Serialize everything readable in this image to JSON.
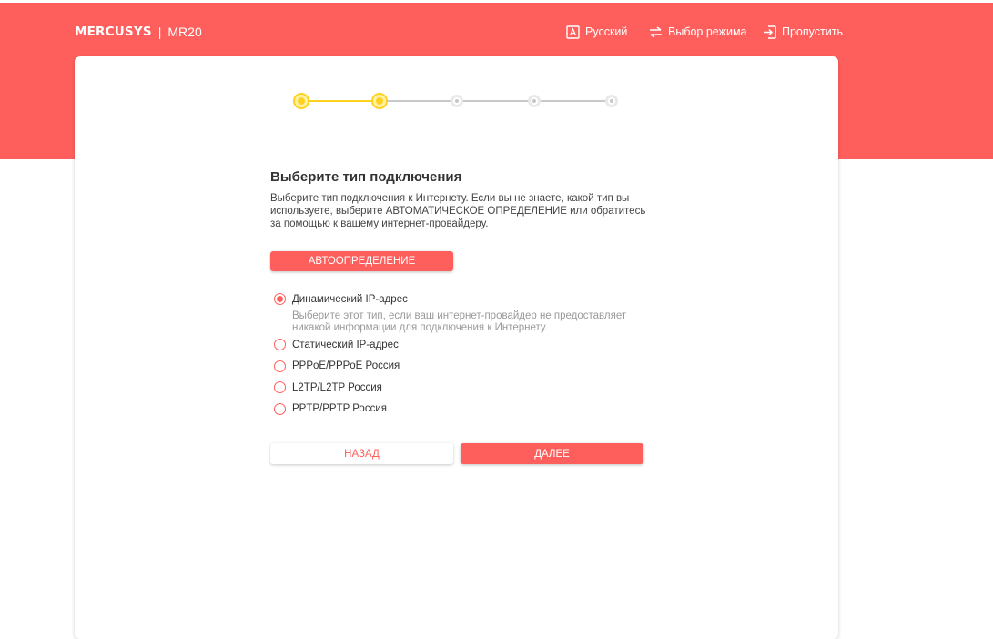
{
  "header": {
    "brand": "MERCUSYS",
    "separator": "|",
    "model": "MR20",
    "links": {
      "language": {
        "label": "Русский",
        "icon": "language-icon"
      },
      "mode": {
        "label": "Выбор режима",
        "icon": "swap-arrows-icon"
      },
      "skip": {
        "label": "Пропустить",
        "icon": "exit-icon"
      }
    }
  },
  "stepper": {
    "total_steps": 5,
    "current_step": 2
  },
  "main": {
    "title": "Выберите тип подключения",
    "description": "Выберите тип подключения к Интернету. Если вы не знаете, какой тип вы используете, выберите АВТОМАТИЧЕСКОЕ ОПРЕДЕЛЕНИЕ или обратитесь за помощью к вашему интернет-провайдеру.",
    "auto_detect_label": "АВТООПРЕДЕЛЕНИЕ",
    "options": [
      {
        "label": "Динамический IP-адрес",
        "checked": true,
        "note": "Выберите этот тип, если ваш интернет-провайдер не предоставляет никакой информации для подключения к Интернету."
      },
      {
        "label": "Статический IP-адрес",
        "checked": false
      },
      {
        "label": "PPPoE/PPPoE Россия",
        "checked": false
      },
      {
        "label": "L2TP/L2TP Россия",
        "checked": false
      },
      {
        "label": "PPTP/PPTP Россия",
        "checked": false
      }
    ],
    "back_label": "НАЗАД",
    "next_label": "ДАЛЕЕ"
  },
  "colors": {
    "accent": "#ff5f5c",
    "step_active": "#ffd21f",
    "step_idle": "#c7c7c7"
  }
}
